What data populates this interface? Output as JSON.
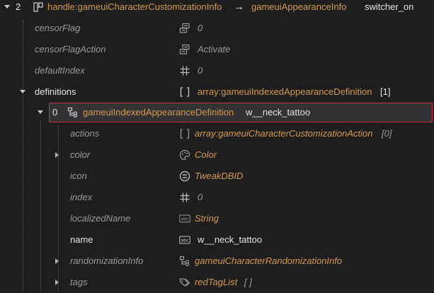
{
  "header": {
    "index": "2",
    "handle": "handle:gameuiCharacterCustomizationInfo",
    "arrow": "→",
    "target_type": "gameuiAppearanceInfo",
    "target_name": "switcher_on"
  },
  "rows": [
    {
      "name": "censorFlag",
      "icon": "flags-icon",
      "value": "0"
    },
    {
      "name": "censorFlagAction",
      "icon": "flags-icon",
      "value": "Activate"
    },
    {
      "name": "defaultIndex",
      "icon": "hash-icon",
      "value": "0"
    },
    {
      "name": "definitions",
      "icon": "array-bracket-icon",
      "value": "array:gameuiIndexedAppearanceDefinition",
      "count": "[1]"
    }
  ],
  "selected_item": {
    "index": "0",
    "type": "gameuiIndexedAppearanceDefinition",
    "name": "w__neck_tattoo"
  },
  "children": [
    {
      "name": "actions",
      "icon": "array-bracket-icon",
      "value": "array:gameuiCharacterCustomizationAction",
      "count": "[0]"
    },
    {
      "name": "color",
      "icon": "palette-icon",
      "value": "Color"
    },
    {
      "name": "icon",
      "icon": "tweakdb-icon",
      "value": "TweakDBID"
    },
    {
      "name": "index",
      "icon": "hash-icon",
      "value": "0"
    },
    {
      "name": "localizedName",
      "icon": "string-abc-icon",
      "value": "String"
    },
    {
      "name": "name",
      "icon": "string-abc-icon",
      "value": "w__neck_tattoo"
    },
    {
      "name": "randomizationInfo",
      "icon": "link-icon",
      "value": "gameuiCharacterRandomizationInfo"
    },
    {
      "name": "tags",
      "icon": "tags-icon",
      "value": "redTagList",
      "suffix": "[ ]"
    }
  ]
}
